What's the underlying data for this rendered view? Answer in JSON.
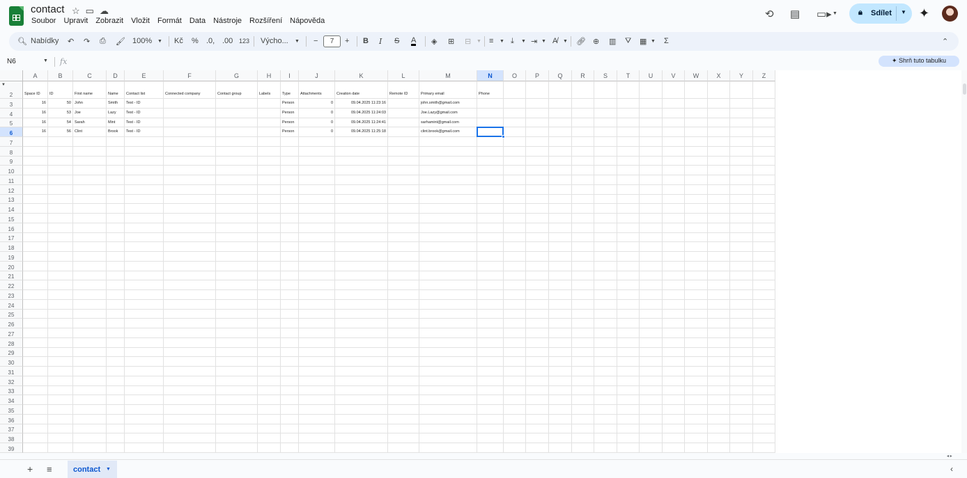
{
  "app": {
    "doc_title": "contact",
    "menu": [
      "Soubor",
      "Upravit",
      "Zobrazit",
      "Vložit",
      "Formát",
      "Data",
      "Nástroje",
      "Rozšíření",
      "Nápověda"
    ],
    "share_label": "Sdílet",
    "summarize_label": "Shrň tuto tabulku"
  },
  "toolbar": {
    "search_label": "Nabídky",
    "zoom": "100%",
    "currency": "Kč",
    "percent": "%",
    "dec_less": ".0,",
    "dec_more": ".00",
    "format_number": "123",
    "font": "Výcho...",
    "font_size": "7"
  },
  "formula_bar": {
    "name_box": "N6",
    "fx": "fx"
  },
  "sheet": {
    "columns": [
      "A",
      "B",
      "C",
      "D",
      "E",
      "F",
      "G",
      "H",
      "I",
      "J",
      "K",
      "L",
      "M",
      "N",
      "O",
      "P",
      "Q",
      "R",
      "S",
      "T",
      "U",
      "V",
      "W",
      "X",
      "Y",
      "Z"
    ],
    "selected_column": "N",
    "row_numbers": [
      "2",
      "3",
      "4",
      "5",
      "6",
      "7",
      "8",
      "9",
      "10",
      "11",
      "12",
      "13",
      "14",
      "15",
      "16",
      "17",
      "18",
      "19",
      "20",
      "21",
      "22",
      "23",
      "24",
      "25",
      "26",
      "27",
      "28",
      "29",
      "30",
      "31",
      "32",
      "33",
      "34",
      "35",
      "36",
      "37",
      "38",
      "39"
    ],
    "selected_row": "6",
    "headers": [
      "Space ID",
      "ID",
      "First name",
      "Name",
      "Contact list",
      "Connected company",
      "Contact group",
      "Labels",
      "Type",
      "Attachments",
      "Creation date",
      "Remote ID",
      "Primary email",
      "Phone"
    ],
    "rows": [
      [
        "16",
        "50",
        "John",
        "Smith",
        "Test - ID",
        "",
        "",
        "",
        "Person",
        "0",
        "09.04.2025 11:23:16",
        "",
        "john.smith@gmail.com",
        ""
      ],
      [
        "16",
        "53",
        "Joe",
        "Lazy",
        "Test - ID",
        "",
        "",
        "",
        "Person",
        "0",
        "09.04.2025 11:24:03",
        "",
        "Joe.Lazy@gmail.com",
        ""
      ],
      [
        "16",
        "54",
        "Sarah",
        "Mint",
        "Test - ID",
        "",
        "",
        "",
        "Person",
        "0",
        "09.04.2025 11:24:41",
        "",
        "sarhamint@gmail.com",
        ""
      ],
      [
        "16",
        "56",
        "Clint",
        "Brook",
        "Test - ID",
        "",
        "",
        "",
        "Person",
        "0",
        "09.04.2025 11:25:18",
        "",
        "clint.brook@gmail.com",
        ""
      ]
    ]
  },
  "bottom": {
    "sheet_tab": "contact"
  }
}
